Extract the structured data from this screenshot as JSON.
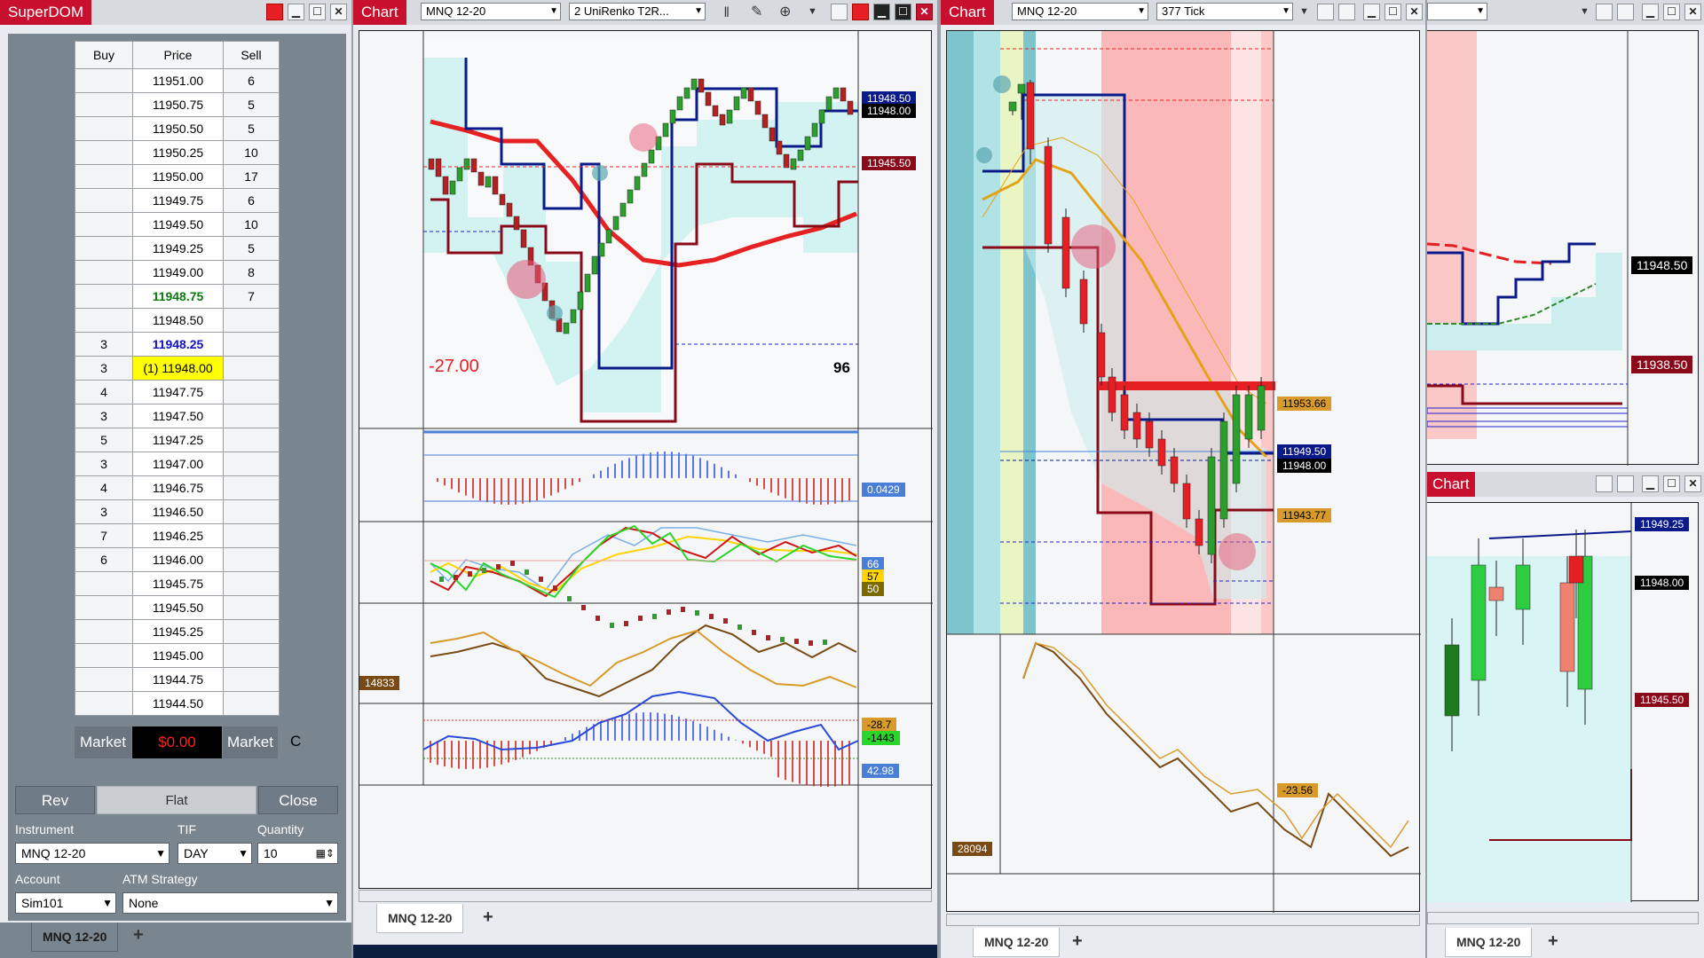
{
  "superdom": {
    "title": "SuperDOM",
    "headers": {
      "buy": "Buy",
      "price": "Price",
      "sell": "Sell"
    },
    "rows": [
      {
        "buy": "",
        "price": "11951.00",
        "sell": "6"
      },
      {
        "buy": "",
        "price": "11950.75",
        "sell": "5"
      },
      {
        "buy": "",
        "price": "11950.50",
        "sell": "5"
      },
      {
        "buy": "",
        "price": "11950.25",
        "sell": "10"
      },
      {
        "buy": "",
        "price": "11950.00",
        "sell": "17"
      },
      {
        "buy": "",
        "price": "11949.75",
        "sell": "6"
      },
      {
        "buy": "",
        "price": "11949.50",
        "sell": "10"
      },
      {
        "buy": "",
        "price": "11949.25",
        "sell": "5"
      },
      {
        "buy": "",
        "price": "11949.00",
        "sell": "8"
      },
      {
        "buy": "",
        "price": "11948.75",
        "sell": "7",
        "style": "ask"
      },
      {
        "buy": "",
        "price": "11948.50",
        "sell": ""
      },
      {
        "buy": "3",
        "price": "11948.25",
        "sell": "",
        "style": "bid"
      },
      {
        "buy": "3",
        "price": "(1) 11948.00",
        "sell": "",
        "style": "position"
      },
      {
        "buy": "4",
        "price": "11947.75",
        "sell": ""
      },
      {
        "buy": "3",
        "price": "11947.50",
        "sell": ""
      },
      {
        "buy": "5",
        "price": "11947.25",
        "sell": ""
      },
      {
        "buy": "3",
        "price": "11947.00",
        "sell": ""
      },
      {
        "buy": "4",
        "price": "11946.75",
        "sell": ""
      },
      {
        "buy": "3",
        "price": "11946.50",
        "sell": ""
      },
      {
        "buy": "7",
        "price": "11946.25",
        "sell": ""
      },
      {
        "buy": "6",
        "price": "11946.00",
        "sell": ""
      },
      {
        "buy": "",
        "price": "11945.75",
        "sell": ""
      },
      {
        "buy": "",
        "price": "11945.50",
        "sell": ""
      },
      {
        "buy": "",
        "price": "11945.25",
        "sell": ""
      },
      {
        "buy": "",
        "price": "11945.00",
        "sell": ""
      },
      {
        "buy": "",
        "price": "11944.75",
        "sell": ""
      },
      {
        "buy": "",
        "price": "11944.50",
        "sell": ""
      }
    ],
    "market_left": "Market",
    "pnl": "$0.00",
    "market_right": "Market",
    "c_label": "C",
    "buttons": {
      "rev": "Rev",
      "flat": "Flat",
      "close": "Close"
    },
    "labels": {
      "instrument": "Instrument",
      "tif": "TIF",
      "quantity": "Quantity",
      "account": "Account",
      "atm": "ATM Strategy"
    },
    "instrument": "MNQ 12-20",
    "tif": "DAY",
    "quantity": "10",
    "account": "Sim101",
    "atm": "None",
    "tab": "MNQ 12-20",
    "tab_add": "+"
  },
  "chart1": {
    "title": "Chart",
    "instrument": "MNQ 12-20",
    "bartype": "2 UniRenko T2R...",
    "pnl_text": "-27.00",
    "count_text": "96",
    "price_labels": [
      "11948.50",
      "11948.00",
      "11945.50"
    ],
    "osc1_label": "0.0429",
    "osc2_labels": [
      "66",
      "57",
      "50"
    ],
    "osc3_left": "14833",
    "osc3_labels": [
      "-28.7",
      "-1443"
    ],
    "osc4_label": "42.98",
    "tab": "MNQ 12-20",
    "tab_add": "+"
  },
  "chart2": {
    "title": "Chart",
    "instrument": "MNQ 12-20",
    "bartype": "377 Tick",
    "price_labels": [
      "11953.66",
      "11949.50",
      "11948.00",
      "11943.77"
    ],
    "osc_left": "28094",
    "osc_label": "-23.56",
    "tab": "MNQ 12-20",
    "tab_add": "+"
  },
  "chart3": {
    "price_labels": [
      "11948.50",
      "11938.50"
    ],
    "tab": "MNQ 12-20",
    "tab_add": "+"
  },
  "chart4": {
    "title": "Chart",
    "price_labels": [
      "11949.25",
      "11948.00",
      "11945.50"
    ]
  },
  "colors": {
    "brand_red": "#c8102e",
    "ask_green": "#0a7a0a",
    "bid_blue": "#1010d0",
    "position_yellow": "#ffff00"
  }
}
